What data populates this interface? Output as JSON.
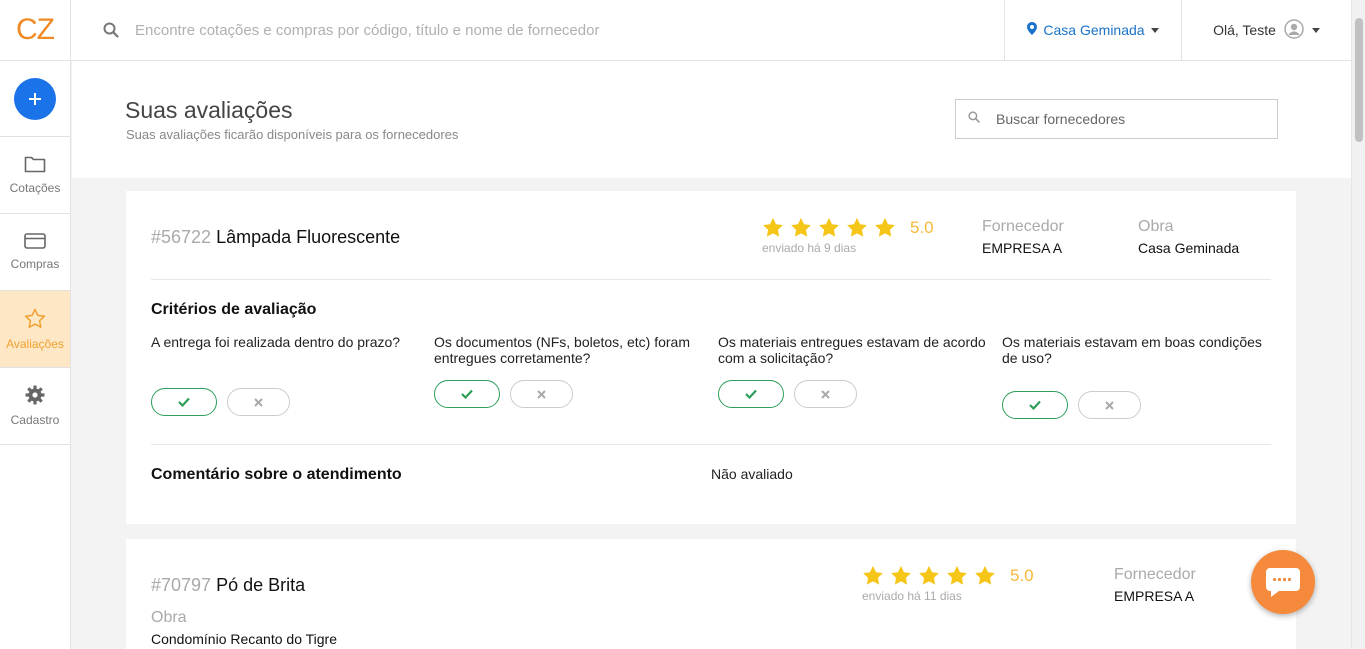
{
  "app": {
    "logo_text": "CZ"
  },
  "header": {
    "search_placeholder": "Encontre cotações e compras por código, título e nome de fornecedor",
    "project": "Casa Geminada",
    "greeting": "Olá, Teste"
  },
  "sidebar": {
    "items": [
      {
        "label": "Cotações",
        "icon": "folder-icon"
      },
      {
        "label": "Compras",
        "icon": "credit-card-icon"
      },
      {
        "label": "Avaliações",
        "icon": "star-icon"
      },
      {
        "label": "Cadastro",
        "icon": "gear-icon"
      }
    ],
    "active_index": 2
  },
  "page": {
    "title": "Suas avaliações",
    "subtitle": "Suas avaliações ficarão disponíveis para os fornecedores",
    "supplier_search_placeholder": "Buscar fornecedores"
  },
  "reviews": [
    {
      "number": "#56722",
      "title": "Lâmpada Fluorescente",
      "stars": 5,
      "score": "5.0",
      "sent": "enviado há 9 dias",
      "supplier_label": "Fornecedor",
      "supplier": "EMPRESA A",
      "site_label": "Obra",
      "site": "Casa Geminada",
      "criteria_title": "Critérios de avaliação",
      "criteria": [
        {
          "question": "A entrega foi realizada dentro do prazo?",
          "answer": "yes"
        },
        {
          "question": "Os documentos (NFs, boletos, etc) foram entregues corretamente?",
          "answer": "yes"
        },
        {
          "question": "Os materiais entregues estavam de acordo com a solicitação?",
          "answer": "yes"
        },
        {
          "question": "Os materiais estavam em boas condições de uso?",
          "answer": "yes"
        }
      ],
      "comment_title": "Comentário sobre o atendimento",
      "comment": "Não avaliado"
    },
    {
      "number": "#70797",
      "title": "Pó de Brita",
      "stars": 5,
      "score": "5.0",
      "sent": "enviado há 11 dias",
      "supplier_label": "Fornecedor",
      "supplier": "EMPRESA A",
      "site_label": "Obra",
      "site": "Condomínio Recanto do Tigre"
    }
  ],
  "colors": {
    "accent": "#1a73e8",
    "brand": "#f08a24",
    "star": "#f5c518",
    "yes": "#2e9e5b",
    "active_nav_bg": "#fde7c4"
  }
}
